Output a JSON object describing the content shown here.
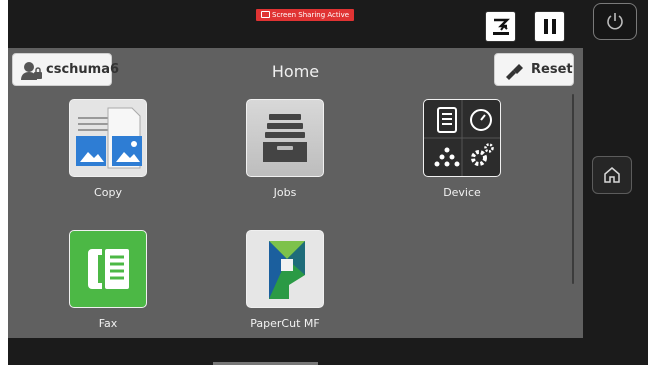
{
  "status": {
    "screen_sharing": "Screen Sharing Active"
  },
  "header": {
    "user": "cschuma6",
    "title": "Home",
    "reset_label": "Reset"
  },
  "apps": [
    {
      "label": "Copy",
      "icon": "copy-icon"
    },
    {
      "label": "Jobs",
      "icon": "jobs-icon"
    },
    {
      "label": "Device",
      "icon": "device-icon"
    },
    {
      "label": "Fax",
      "icon": "fax-icon"
    },
    {
      "label": "PaperCut MF",
      "icon": "papercut-icon"
    }
  ],
  "colors": {
    "panel": "#606060",
    "frame": "#1b1b1b",
    "share_badge": "#e03333",
    "fax_green": "#4cb845"
  }
}
